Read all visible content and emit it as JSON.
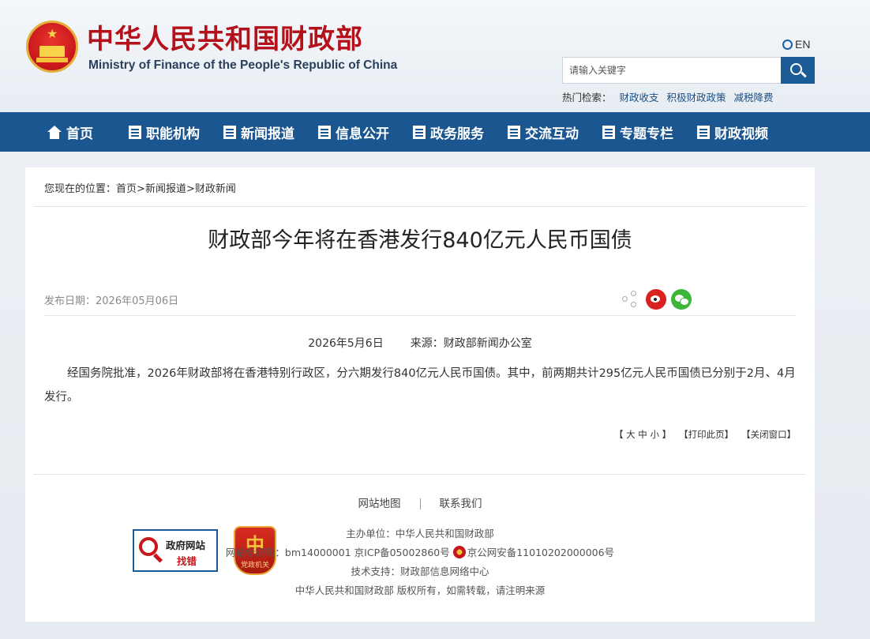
{
  "header": {
    "title_cn": "中华人民共和国财政部",
    "title_en": "Ministry of Finance of the People's Republic of China",
    "lang_label": "EN",
    "search": {
      "placeholder": "请输入关键字"
    },
    "hot": {
      "label": "热门检索：",
      "items": [
        "财政收支",
        "积极财政政策",
        "减税降费"
      ]
    }
  },
  "nav": {
    "items": [
      {
        "label": "首页",
        "icon": "home-icon"
      },
      {
        "label": "职能机构",
        "icon": "list-icon"
      },
      {
        "label": "新闻报道",
        "icon": "news-icon"
      },
      {
        "label": "信息公开",
        "icon": "document-icon"
      },
      {
        "label": "政务服务",
        "icon": "service-icon"
      },
      {
        "label": "交流互动",
        "icon": "interaction-icon"
      },
      {
        "label": "专题专栏",
        "icon": "topic-icon"
      },
      {
        "label": "财政视频",
        "icon": "video-icon"
      }
    ]
  },
  "breadcrumb": {
    "prefix": "您现在的位置：",
    "items": [
      "首页",
      "新闻报道",
      "财政新闻"
    ],
    "separator": ">"
  },
  "article": {
    "title": "财政部今年将在香港发行840亿元人民币国债",
    "pubdate": "发布日期：2026年05月06日",
    "date": "2026年5月6日",
    "source": "来源：财政部新闻办公室",
    "body": "经国务院批准，2026年财政部将在香港特别行政区，分六期发行840亿元人民币国债。其中，前两期共计295亿元人民币国债已分别于2月、4月发行。"
  },
  "tools": {
    "font_size": "【 大 中 小 】",
    "print": "【打印此页】",
    "close": "【关闭窗口】"
  },
  "footer": {
    "links": [
      "网站地图",
      "联系我们"
    ],
    "host": "主办单位：中华人民共和国财政部",
    "site_id": "网站标识码：bm14000001",
    "icp": "京ICP备05002860号",
    "police": "京公网安备11010202000006号",
    "tech": "技术支持：财政部信息网络中心",
    "copyright": "中华人民共和国财政部  版权所有，如需转载，请注明来源",
    "gov_badge": {
      "line1": "政府网站",
      "line2": "找错"
    },
    "party_badge": {
      "glyph": "中",
      "text": "党政机关"
    }
  },
  "colors": {
    "brand_red": "#b5111a",
    "nav_blue": "#1b5690",
    "weibo_red": "#d9221f",
    "wechat_green": "#3bb53a"
  }
}
